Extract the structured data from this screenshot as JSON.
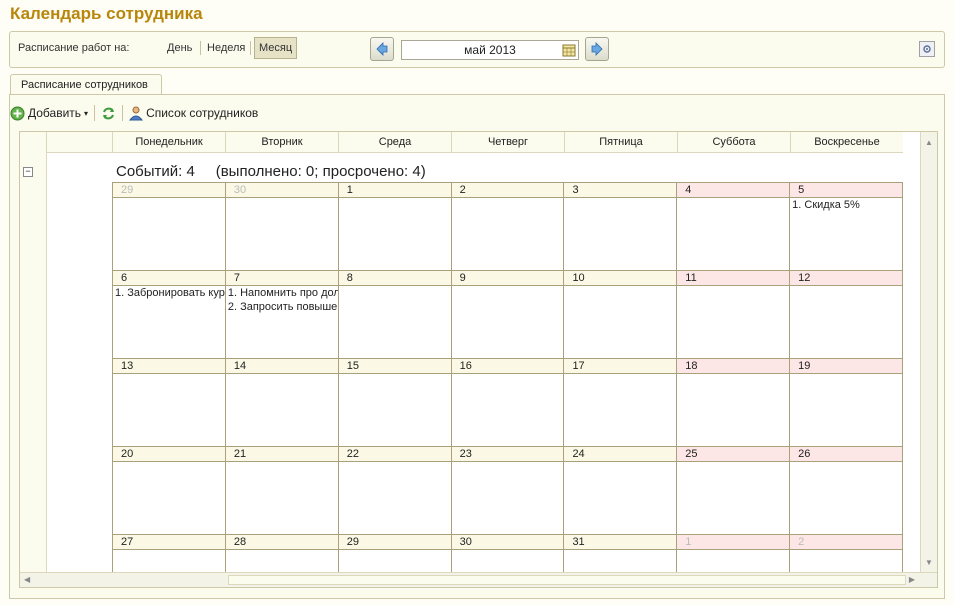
{
  "window": {
    "title": "Календарь сотрудника"
  },
  "toolbar": {
    "schedule_label": "Расписание работ на:",
    "views": [
      "День",
      "Неделя",
      "Месяц"
    ],
    "active_view": "Месяц",
    "period": "май 2013"
  },
  "tabs": [
    {
      "label": "Расписание сотрудников"
    }
  ],
  "panel_toolbar": {
    "add_label": "Добавить",
    "employees_label": "Список сотрудников"
  },
  "calendar": {
    "weekdays": [
      "Понедельник",
      "Вторник",
      "Среда",
      "Четверг",
      "Пятница",
      "Суббота",
      "Воскресенье"
    ],
    "summary_events": "Событий: 4",
    "summary_details": "(выполнено: 0; просрочено: 4)",
    "weeks": [
      [
        {
          "d": "29",
          "other": true
        },
        {
          "d": "30",
          "other": true
        },
        {
          "d": "1"
        },
        {
          "d": "2"
        },
        {
          "d": "3"
        },
        {
          "d": "4",
          "we": true
        },
        {
          "d": "5",
          "we": true,
          "events": [
            "1. Скидка 5%"
          ]
        }
      ],
      [
        {
          "d": "6",
          "events": [
            "1. Забронировать кур"
          ]
        },
        {
          "d": "7",
          "events": [
            "1. Напомнить про дол",
            "2. Запросить повыше"
          ]
        },
        {
          "d": "8"
        },
        {
          "d": "9"
        },
        {
          "d": "10"
        },
        {
          "d": "11",
          "we": true
        },
        {
          "d": "12",
          "we": true
        }
      ],
      [
        {
          "d": "13"
        },
        {
          "d": "14"
        },
        {
          "d": "15"
        },
        {
          "d": "16"
        },
        {
          "d": "17"
        },
        {
          "d": "18",
          "we": true
        },
        {
          "d": "19",
          "we": true
        }
      ],
      [
        {
          "d": "20"
        },
        {
          "d": "21"
        },
        {
          "d": "22"
        },
        {
          "d": "23"
        },
        {
          "d": "24"
        },
        {
          "d": "25",
          "we": true
        },
        {
          "d": "26",
          "we": true
        }
      ],
      [
        {
          "d": "27"
        },
        {
          "d": "28"
        },
        {
          "d": "29"
        },
        {
          "d": "30"
        },
        {
          "d": "31"
        },
        {
          "d": "1",
          "we": true,
          "other": true
        },
        {
          "d": "2",
          "we": true,
          "other": true
        }
      ]
    ]
  },
  "colors": {
    "title": "#b8860b",
    "weekend": "#fde6e6",
    "border": "#a9a07c"
  },
  "icons": [
    "back-arrow-icon",
    "forward-arrow-icon",
    "calendar-icon",
    "settings-icon",
    "add-icon",
    "refresh-icon",
    "person-icon",
    "collapse-icon"
  ]
}
